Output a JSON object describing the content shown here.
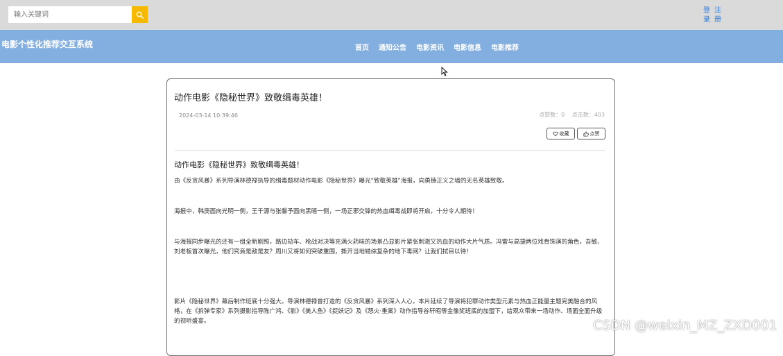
{
  "search": {
    "placeholder": "输入关键词"
  },
  "auth": {
    "login_label": "登录",
    "register_label": "注册"
  },
  "site": {
    "title": "电影个性化推荐交互系统"
  },
  "nav": {
    "items": [
      "首页",
      "通知公告",
      "电影资讯",
      "电影信息",
      "电影推荐"
    ]
  },
  "article": {
    "title": "动作电影《隐秘世界》致敬缉毒英雄！",
    "date": "2024-03-14 10:39:46",
    "likes_label": "点赞数：0",
    "clicks_label": "点击数：403",
    "favorite_label": "收藏",
    "like_label": "点赞",
    "heading": "动作电影《隐秘世界》致敬缉毒英雄！",
    "paragraphs": [
      "由《反贪风暴》系列导演林德禄执导的缉毒题材动作电影《隐秘世界》曝光“致敬英雄”海报，向勇铸正义之墙的无名英雄致敬。",
      "海报中，韩庚面向光明一侧，王千源与张馨予面向黑暗一侧，一场正邪交锋的热血缉毒战即将开启，十分令人期待！",
      "与海报同步曝光的还有一组全新剧照，路边劫车、枪战对决等充满火药味的场景凸显影片紧张刺激又热血的动作大片气质。冯雷与高捷两位戏骨饰演的角色，吾敏、刘老板首次曝光，他们究竟是敌是友？周川又将如何突破重围，撕开当地错综复杂的地下毒网？让我们拭目以待！",
      "影片《隐秘世界》幕后制作班底十分强大。导演林德禄曾打造的《反贪风暴》系列深入人心，本片延续了导演将犯罪动作类型元素与热血正能量主题完美融合的风格，在《拆弹专家》系列摄影指导陈广鸿、《影》《美人鱼》《捉妖记》及《怒火·重案》动作指导谷轩昭等金像奖班底的加盟下，给观众带来一场动作、场面全面升级的视听盛宴。"
    ]
  },
  "watermark": "CSDN @weixin_MZ_ZXD001",
  "colors": {
    "topbar": "#dadada",
    "navbar": "#82afe0",
    "search_button": "#f6b900",
    "auth_link": "#2c7be0"
  }
}
